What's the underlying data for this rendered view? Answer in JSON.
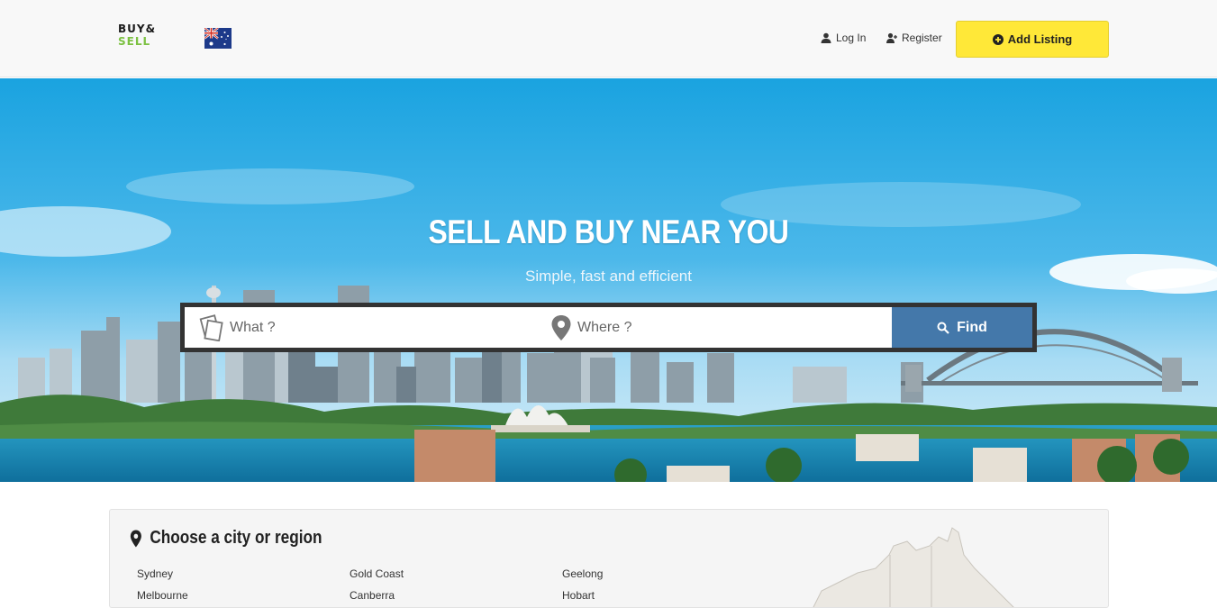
{
  "header": {
    "logo": {
      "line1": "BUY&",
      "line2": "SELL"
    },
    "flag": "australia-flag",
    "login_label": "Log In",
    "register_label": "Register",
    "add_listing_label": "Add Listing",
    "accent_color": "#ffe838"
  },
  "hero": {
    "title": "SELL AND BUY NEAR YOU",
    "subtitle": "Simple, fast and efficient",
    "search": {
      "what_placeholder": "What ?",
      "where_placeholder": "Where ?",
      "find_label": "Find",
      "find_color": "#4478aa"
    }
  },
  "locations": {
    "title": "Choose a city or region",
    "cities": [
      [
        "Sydney",
        "Melbourne"
      ],
      [
        "Gold Coast",
        "Canberra"
      ],
      [
        "Geelong",
        "Hobart"
      ]
    ]
  }
}
